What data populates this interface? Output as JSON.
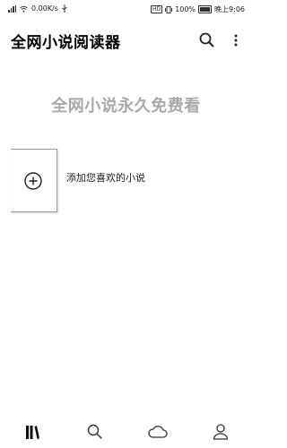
{
  "status_bar": {
    "network_speed": "0.00K/s",
    "battery_percent": "100%",
    "time": "晚上9:06",
    "badge": "HD"
  },
  "app_bar": {
    "title": "全网小说阅读器",
    "search_icon": "search-icon",
    "more_icon": "more-vert-icon"
  },
  "main": {
    "slogan": "全网小说永久免费看",
    "add_book_label": "添加您喜欢的小说",
    "add_icon": "add-circle-icon"
  },
  "bottom_nav": {
    "items": [
      {
        "icon": "bookshelf-icon"
      },
      {
        "icon": "search-icon"
      },
      {
        "icon": "cloud-icon"
      },
      {
        "icon": "person-icon"
      }
    ]
  }
}
